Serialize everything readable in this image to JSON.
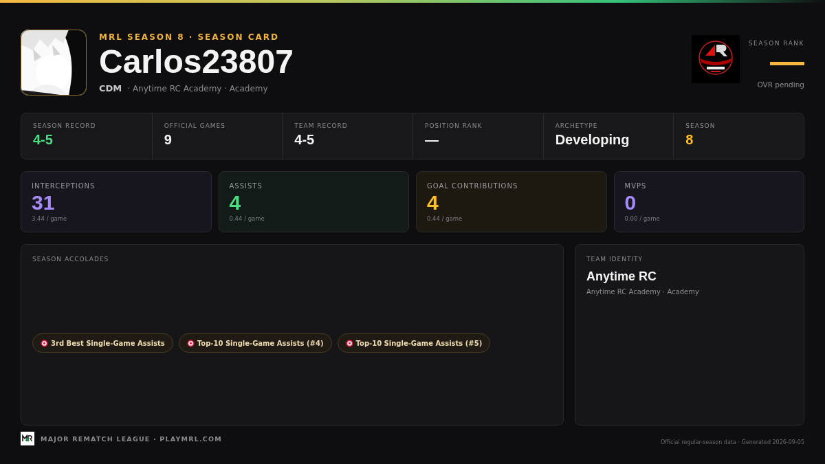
{
  "header": {
    "eyebrow": "MRL SEASON 8 · SEASON CARD",
    "player": "Carlos23807",
    "position": "CDM",
    "team_line": "· Anytime RC Academy · Academy",
    "rank_label": "SEASON RANK",
    "rank_note": "OVR pending"
  },
  "summary": [
    {
      "label": "SEASON RECORD",
      "value": "4-5",
      "color": "#4ade80"
    },
    {
      "label": "OFFICIAL GAMES",
      "value": "9",
      "color": "#f4f4f5"
    },
    {
      "label": "TEAM RECORD",
      "value": "4-5",
      "color": "#f4f4f5"
    },
    {
      "label": "POSITION RANK",
      "value": "—",
      "color": "#f4f4f5"
    },
    {
      "label": "ARCHETYPE",
      "value": "Developing",
      "color": "#f4f4f5"
    },
    {
      "label": "SEASON",
      "value": "8",
      "color": "#fbbf24"
    }
  ],
  "stats": [
    {
      "label": "INTERCEPTIONS",
      "value": "31",
      "per_game": "3.44 / game",
      "color": "#a78bfa"
    },
    {
      "label": "ASSISTS",
      "value": "4",
      "per_game": "0.44 / game",
      "color": "#4ade80"
    },
    {
      "label": "GOAL CONTRIBUTIONS",
      "value": "4",
      "per_game": "0.44 / game",
      "color": "#fbbf24"
    },
    {
      "label": "MVPS",
      "value": "0",
      "per_game": "0.00 / game",
      "color": "#a78bfa"
    }
  ],
  "accolades": {
    "title": "SEASON ACCOLADES",
    "items": [
      "3rd Best Single-Game Assists",
      "Top-10 Single-Game Assists (#4)",
      "Top-10 Single-Game Assists (#5)"
    ]
  },
  "team_identity": {
    "title": "TEAM IDENTITY",
    "name": "Anytime RC",
    "sub": "Anytime RC Academy · Academy"
  },
  "footer": {
    "brand": "MAJOR REMATCH LEAGUE · PLAYMRL.COM",
    "note": "Official regular-season data · Generated 2026-09-05"
  }
}
